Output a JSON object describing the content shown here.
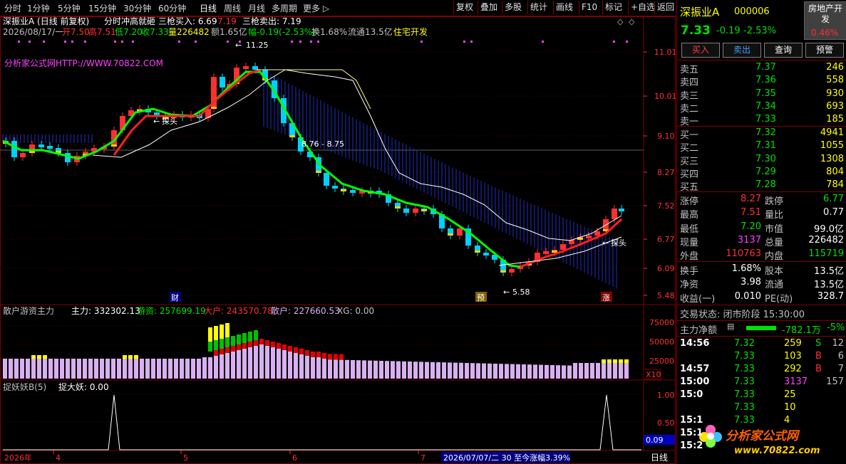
{
  "toolbar": {
    "left": [
      "分时",
      "1分钟",
      "5分钟",
      "15分钟",
      "30分钟",
      "60分钟",
      "日线",
      "周线",
      "月线",
      "多周期",
      "更多 ▷"
    ],
    "right": [
      "复权",
      "叠加",
      "多股",
      "统计",
      "画线",
      "F10",
      "标记",
      "+自选",
      "返回"
    ]
  },
  "chart": {
    "title": "深振业A (日线 前复权)",
    "formula": "分时冲高就砸",
    "buy_label": "三枪买入: 6.69",
    "buy_red": "7.19",
    "sell_label": "三枪卖出: 7.19",
    "ohlc_line": "2026/08/17/一",
    "open": "开7.50",
    "high": "高7.51",
    "low": "低7.20",
    "close": "收7.33",
    "volume": "量226482",
    "amount": "额1.65亿",
    "change": "幅-0.19(-2.53%)",
    "turnover": "换1.68%",
    "float": "流通13.5亿",
    "sector": "住宅开发",
    "site": "分析家公式网HTTP://WWW.70822.COM",
    "hi_mark": "11.25",
    "lo_mark": "5.58",
    "range_label": "8.76 - 8.75",
    "probe_left": "探头",
    "probe_right": "探头",
    "markers": [
      "财",
      "预",
      "涨"
    ],
    "y_ticks": [
      "11.01",
      "10.01",
      "9.10",
      "8.27",
      "7.52",
      "6.77",
      "6.09",
      "5.48"
    ],
    "panel2_title": "散户游资主力",
    "zhuli": "主力: 332302.13",
    "youzi": "游资: 257699.19",
    "dahu": "大户: 243570.78",
    "sanhu": "散户: 227660.53",
    "xg": "XG: 0.00",
    "p2_ticks": [
      "75000",
      "50000",
      "25000"
    ],
    "p2_unit": "X10",
    "panel3_title": "捉妖妖B(5)",
    "zhuodayao": "捉大妖: 0.00",
    "p3_ticks": [
      "1.00",
      "0.50"
    ],
    "p3_value": "0.09",
    "date_axis": [
      "2026年",
      "4",
      "5",
      "6",
      "7"
    ],
    "date_status": "2026/07/07/二 30 至今涨幅3.39%",
    "period_label": "日线",
    "colors": {
      "up": "#ff3030",
      "down": "#00e0ff",
      "ma_green": "#00ff00",
      "ma_red": "#ff2020",
      "ma_white": "#ffffff",
      "volume": "#d8b0f0"
    }
  },
  "quote": {
    "name": "深振业A",
    "code": "000006",
    "badge": "房地产开发",
    "price": "7.33",
    "chg": "-0.19",
    "pct": "-2.53%",
    "badge_pct": "0.46%",
    "buttons": [
      "买入",
      "卖出",
      "查询",
      "预警"
    ],
    "asks": [
      [
        "卖五",
        "7.37",
        "246"
      ],
      [
        "卖四",
        "7.36",
        "558"
      ],
      [
        "卖三",
        "7.35",
        "930"
      ],
      [
        "卖二",
        "7.34",
        "693"
      ],
      [
        "卖一",
        "7.33",
        "185"
      ]
    ],
    "bids": [
      [
        "买一",
        "7.32",
        "4941"
      ],
      [
        "买二",
        "7.31",
        "1055"
      ],
      [
        "买三",
        "7.30",
        "1308"
      ],
      [
        "买四",
        "7.29",
        "804"
      ],
      [
        "买五",
        "7.28",
        "784"
      ]
    ],
    "stats": [
      [
        "涨停",
        "8.27",
        "跌停",
        "6.77"
      ],
      [
        "最高",
        "7.51",
        "量比",
        "0.77"
      ],
      [
        "最低",
        "7.20",
        "市值",
        "99.0亿"
      ],
      [
        "现量",
        "3137",
        "总量",
        "226482"
      ],
      [
        "外盘",
        "110763",
        "内盘",
        "115719"
      ]
    ],
    "stats2": [
      [
        "换手",
        "1.68%",
        "股本",
        "13.5亿"
      ],
      [
        "净资",
        "3.98",
        "流通",
        "13.5亿"
      ],
      [
        "收益(一)",
        "0.010",
        "PE(动)",
        "328.7"
      ]
    ],
    "trade_state": "交易状态: 闭市阶段 15:30:00",
    "net_label": "主力净额",
    "net_value": "-782.1万",
    "net_pct": "-5%",
    "ticks": [
      [
        "14:56",
        "7.32",
        "259",
        "S",
        "12"
      ],
      [
        "",
        "7.33",
        "103",
        "B",
        "6"
      ],
      [
        "14:57",
        "7.33",
        "292",
        "B",
        "7"
      ],
      [
        "15:00",
        "7.33",
        "3137",
        "",
        "157"
      ],
      [
        "15:0",
        "7.33",
        "25",
        "",
        ""
      ],
      [
        "",
        "7.33",
        "10",
        "",
        ""
      ],
      [
        "15:1",
        "7.33",
        "4",
        "",
        ""
      ],
      [
        "15:1",
        "",
        "",
        "",
        ""
      ],
      [
        "15:2",
        "",
        "",
        "",
        ""
      ]
    ],
    "logo_text": "分析家公式网",
    "logo_url": "www.70822.com"
  }
}
